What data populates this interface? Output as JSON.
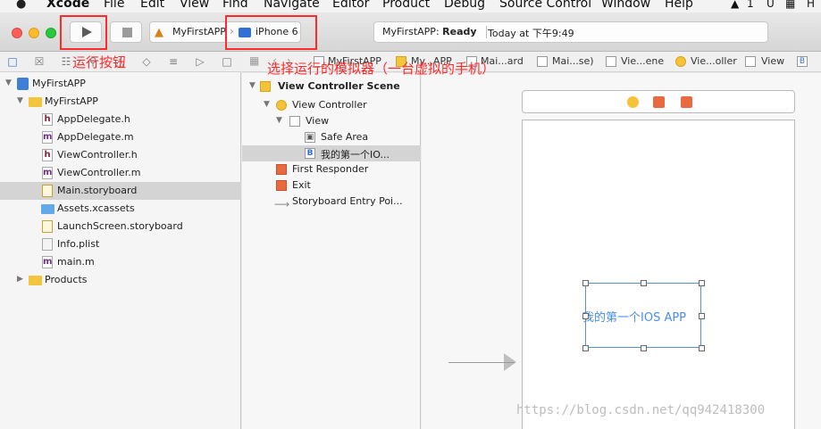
{
  "menubar": {
    "apple": "",
    "items": [
      "Xcode",
      "File",
      "Edit",
      "View",
      "Find",
      "Navigate",
      "Editor",
      "Product",
      "Debug",
      "Source Control",
      "Window",
      "Help"
    ],
    "tray": [
      "1",
      "U",
      "H"
    ]
  },
  "toolbar": {
    "scheme_app": "MyFirstAPP",
    "scheme_device": "iPhone 6",
    "status_project": "MyFirstAPP:",
    "status_state": "Ready",
    "status_time": "Today at 下午9:49"
  },
  "annotations": {
    "run_button": "运行按钮",
    "simulator": "选择运行的模拟器（一台虚拟的手机）"
  },
  "navigator": {
    "items": [
      {
        "label": "MyFirstAPP",
        "type": "project"
      },
      {
        "label": "MyFirstAPP",
        "type": "folder"
      },
      {
        "label": "AppDelegate.h",
        "type": "h"
      },
      {
        "label": "AppDelegate.m",
        "type": "m"
      },
      {
        "label": "ViewController.h",
        "type": "h"
      },
      {
        "label": "ViewController.m",
        "type": "m"
      },
      {
        "label": "Main.storyboard",
        "type": "storyboard"
      },
      {
        "label": "Assets.xcassets",
        "type": "assets"
      },
      {
        "label": "LaunchScreen.storyboard",
        "type": "storyboard"
      },
      {
        "label": "Info.plist",
        "type": "plist"
      },
      {
        "label": "main.m",
        "type": "m"
      },
      {
        "label": "Products",
        "type": "folder"
      }
    ],
    "icons": {
      "h": "h",
      "m": "m"
    }
  },
  "jumpbar": {
    "items": [
      "MyFirstAPP",
      "My...APP",
      "Mai...ard",
      "Mai...se)",
      "Vie...ene",
      "Vie...oller",
      "View",
      "B"
    ]
  },
  "outline": {
    "scene": "View Controller Scene",
    "view_controller": "View Controller",
    "view": "View",
    "safe_area": "Safe Area",
    "label": "我的第一个IO...",
    "first_responder": "First Responder",
    "exit": "Exit",
    "entry_point": "Storyboard Entry Poi..."
  },
  "canvas": {
    "label_text": "我的第一个IOS APP"
  },
  "watermark": "https://blog.csdn.net/qq942418300",
  "colors": {
    "annotation": "#ff2a2a",
    "selection": "#d4d4d4",
    "label_text": "#4a8ee6"
  }
}
